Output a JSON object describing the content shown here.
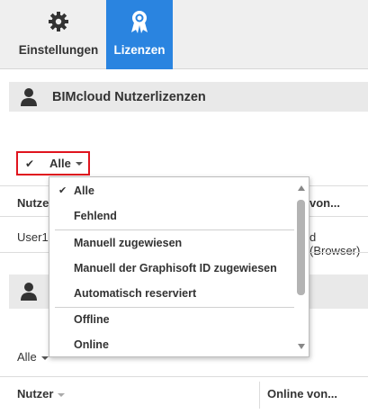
{
  "tabs": {
    "settings_label": "Einstellungen",
    "licenses_label": "Lizenzen"
  },
  "section1": {
    "title": "BIMcloud Nutzerlizenzen"
  },
  "filter_button": {
    "label": "Alle"
  },
  "table1": {
    "col_user": "Nutzer",
    "col_online_partial": "von...",
    "row_user": "User1",
    "row_online_partial": "d (Browser)"
  },
  "filter2": {
    "label": "Alle"
  },
  "table2": {
    "col_user": "Nutzer",
    "col_online": "Online von..."
  },
  "dropdown": {
    "items": [
      {
        "label": "Alle",
        "selected": true
      },
      {
        "label": "Fehlend",
        "selected": false
      },
      {
        "label": "Manuell zugewiesen",
        "selected": false
      },
      {
        "label": "Manuell der Graphisoft ID zugewiesen",
        "selected": false
      },
      {
        "label": "Automatisch reserviert",
        "selected": false
      },
      {
        "label": "Offline",
        "selected": false
      },
      {
        "label": "Online",
        "selected": false
      }
    ]
  },
  "colors": {
    "accent": "#2a84e0",
    "highlight_border": "#e0141e",
    "header_bg": "#e9e9e9",
    "tabbar_bg": "#efefef"
  }
}
